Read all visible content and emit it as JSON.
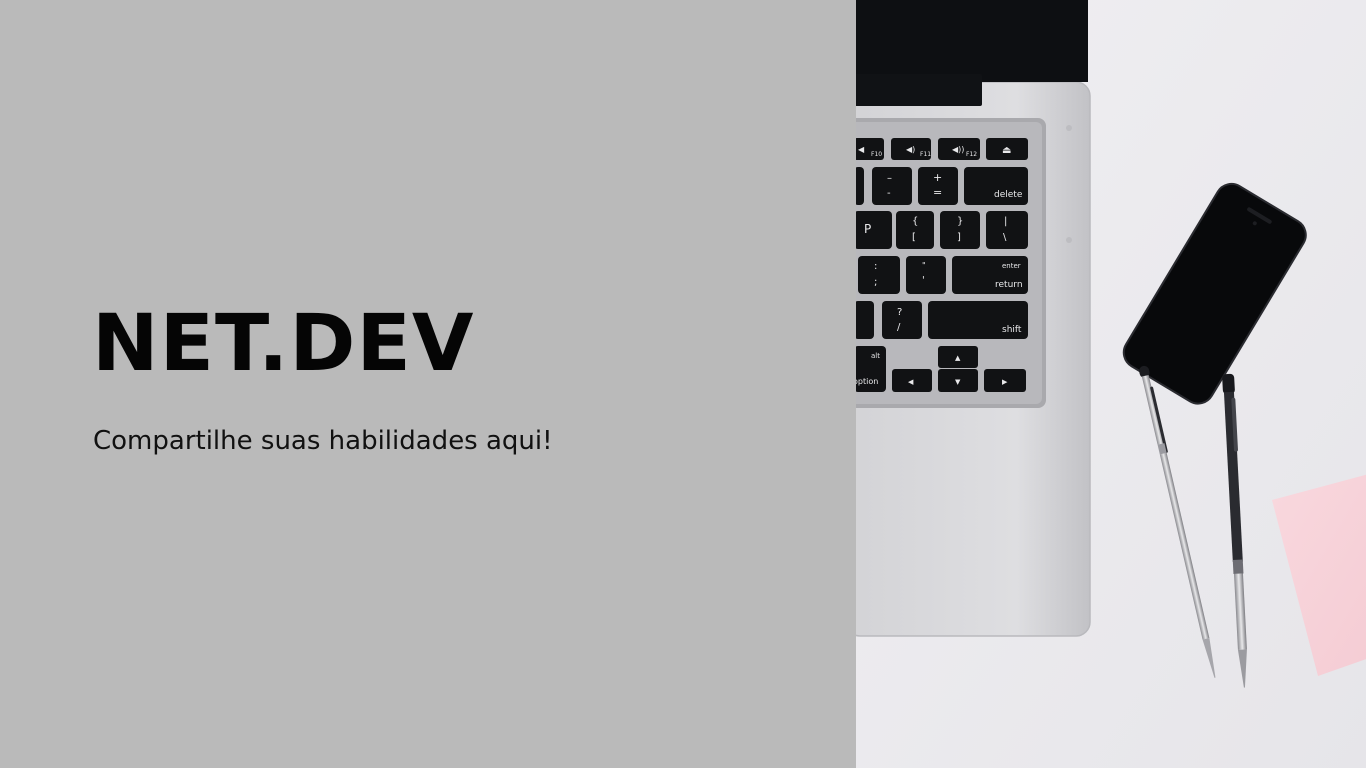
{
  "slide": {
    "title": "NET.DEV",
    "tagline": "Compartilhe suas habilidades aqui!"
  },
  "keyboard": {
    "keys": [
      "F10",
      "F11",
      "F12",
      "delete",
      "P",
      "enter",
      "return",
      "shift",
      "alt",
      "option"
    ]
  },
  "colors": {
    "left_bg": "#bababa",
    "title": "#050505",
    "desk": "#ececee",
    "laptop_body": "#c9c9cb",
    "keys": "#111214",
    "note": "#f7d3da"
  },
  "icons": [
    "volume-down-icon",
    "volume-up-icon",
    "eject-icon",
    "arrow-up-icon",
    "arrow-down-icon",
    "arrow-left-icon",
    "arrow-right-icon"
  ]
}
